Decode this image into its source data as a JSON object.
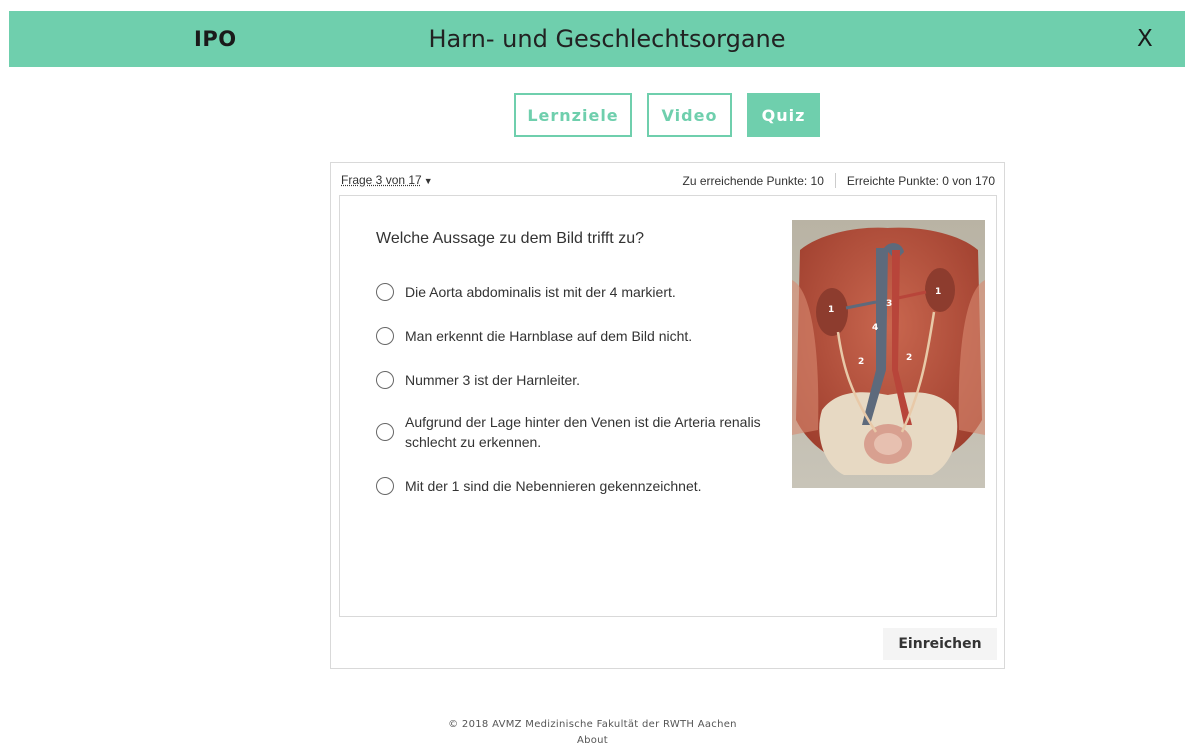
{
  "header": {
    "brand": "IPO",
    "title": "Harn- und Geschlechtsorgane",
    "close_label": "X",
    "color": "#6fcfad"
  },
  "tabs": [
    {
      "label": "Lernziele",
      "active": false
    },
    {
      "label": "Video",
      "active": false
    },
    {
      "label": "Quiz",
      "active": true
    }
  ],
  "quiz": {
    "question_select": "Frage 3 von 17",
    "points_required": "Zu erreichende Punkte: 10",
    "points_achieved": "Erreichte Punkte: 0 von 170",
    "question": "Welche Aussage zu dem Bild trifft zu?",
    "options": [
      "Die Aorta abdominalis ist mit der 4 markiert.",
      "Man erkennt die Harnblase auf dem Bild nicht.",
      "Nummer 3 ist der Harnleiter.",
      "Aufgrund der Lage hinter den Venen ist die Arteria renalis schlecht zu erkennen.",
      "Mit der 1 sind die Nebennieren gekennzeichnet."
    ],
    "figure_labels": [
      "1",
      "1",
      "2",
      "2",
      "3",
      "4"
    ],
    "submit_label": "Einreichen"
  },
  "footer": {
    "copyright": "© 2018 AVMZ Medizinische Fakultät der RWTH Aachen",
    "about": "About"
  }
}
